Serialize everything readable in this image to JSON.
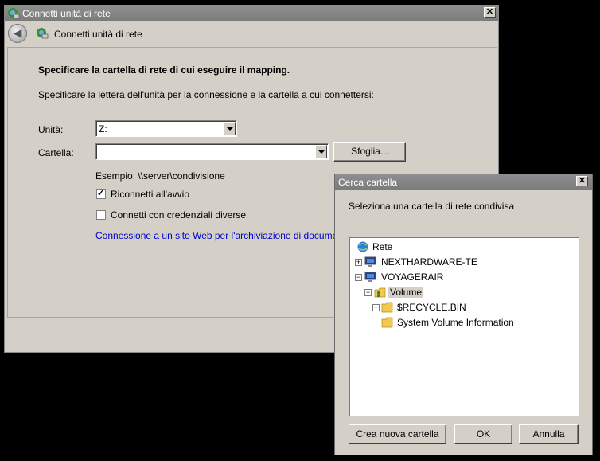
{
  "main_window": {
    "title": "Connetti unità di rete",
    "heading": "Connetti unità di rete",
    "instruction_bold": "Specificare la cartella di rete di cui eseguire il mapping.",
    "instruction": "Specificare la lettera dell'unità per la connessione e la cartella a cui connettersi:",
    "drive_label": "Unità:",
    "drive_value": "Z:",
    "folder_label": "Cartella:",
    "folder_value": "",
    "browse_button": "Sfoglia...",
    "example": "Esempio: \\\\server\\condivisione",
    "reconnect_label": "Riconnetti all'avvio",
    "reconnect_checked": true,
    "credentials_label": "Connetti con credenziali diverse",
    "credentials_checked": false,
    "link_text": "Connessione a un sito Web per l'archiviazione di documenti e immagini"
  },
  "browse_dialog": {
    "title": "Cerca cartella",
    "description": "Seleziona una cartella di rete condivisa",
    "tree": [
      {
        "label": "Rete",
        "icon": "network-icon"
      },
      {
        "label": "NEXTHARDWARE-TE",
        "icon": "computer-icon",
        "expander": "+"
      },
      {
        "label": "VOYAGERAIR",
        "icon": "computer-icon",
        "expander": "−"
      },
      {
        "label": "Volume",
        "icon": "shared-folder-icon",
        "expander": "−",
        "selected": true
      },
      {
        "label": "$RECYCLE.BIN",
        "icon": "folder-icon",
        "expander": "+"
      },
      {
        "label": "System Volume Information",
        "icon": "folder-icon"
      }
    ],
    "new_folder_button": "Crea nuova cartella",
    "ok_button": "OK",
    "cancel_button": "Annulla"
  },
  "close_glyph": "✕"
}
